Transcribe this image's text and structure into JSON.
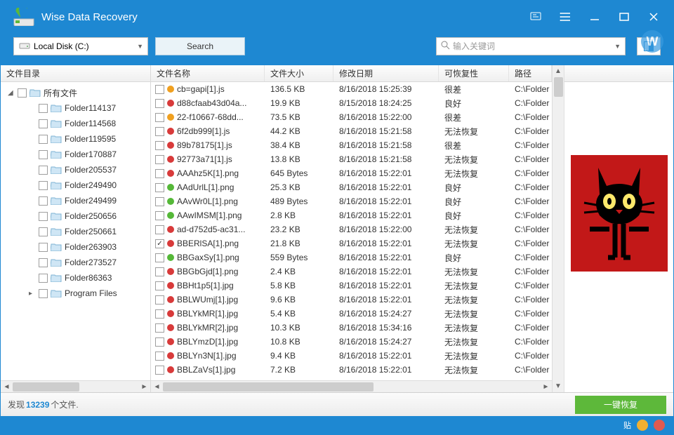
{
  "app": {
    "title": "Wise Data Recovery"
  },
  "toolbar": {
    "drive_label": "Local Disk (C:)",
    "search_label": "Search",
    "search_placeholder": "输入关键词",
    "watermark_letter": "W"
  },
  "sidebar": {
    "header": "文件目录",
    "root_label": "所有文件",
    "folders": [
      {
        "label": "Folder114137"
      },
      {
        "label": "Folder114568"
      },
      {
        "label": "Folder119595"
      },
      {
        "label": "Folder170887"
      },
      {
        "label": "Folder205537"
      },
      {
        "label": "Folder249490"
      },
      {
        "label": "Folder249499"
      },
      {
        "label": "Folder250656"
      },
      {
        "label": "Folder250661"
      },
      {
        "label": "Folder263903"
      },
      {
        "label": "Folder273527"
      },
      {
        "label": "Folder86363"
      },
      {
        "label": "Program Files",
        "expandable": true
      }
    ]
  },
  "grid": {
    "headers": {
      "name": "文件名称",
      "size": "文件大小",
      "date": "修改日期",
      "rec": "可恢复性",
      "path": "路径"
    },
    "rows": [
      {
        "checked": false,
        "status": "orange",
        "name": "cb=gapi[1].js",
        "size": "136.5 KB",
        "date": "8/16/2018 15:25:39",
        "rec": "很差",
        "path": "C:\\Folder"
      },
      {
        "checked": false,
        "status": "red",
        "name": "d88cfaab43d04a...",
        "size": "19.9 KB",
        "date": "8/15/2018 18:24:25",
        "rec": "良好",
        "path": "C:\\Folder"
      },
      {
        "checked": false,
        "status": "orange",
        "name": "22-f10667-68dd...",
        "size": "73.5 KB",
        "date": "8/16/2018 15:22:00",
        "rec": "很差",
        "path": "C:\\Folder"
      },
      {
        "checked": false,
        "status": "red",
        "name": "6f2db999[1].js",
        "size": "44.2 KB",
        "date": "8/16/2018 15:21:58",
        "rec": "无法恢复",
        "path": "C:\\Folder"
      },
      {
        "checked": false,
        "status": "red",
        "name": "89b78175[1].js",
        "size": "38.4 KB",
        "date": "8/16/2018 15:21:58",
        "rec": "很差",
        "path": "C:\\Folder"
      },
      {
        "checked": false,
        "status": "red",
        "name": "92773a71[1].js",
        "size": "13.8 KB",
        "date": "8/16/2018 15:21:58",
        "rec": "无法恢复",
        "path": "C:\\Folder"
      },
      {
        "checked": false,
        "status": "red",
        "name": "AAAhz5K[1].png",
        "size": "645 Bytes",
        "date": "8/16/2018 15:22:01",
        "rec": "无法恢复",
        "path": "C:\\Folder"
      },
      {
        "checked": false,
        "status": "green",
        "name": "AAdUrlL[1].png",
        "size": "25.3 KB",
        "date": "8/16/2018 15:22:01",
        "rec": "良好",
        "path": "C:\\Folder"
      },
      {
        "checked": false,
        "status": "green",
        "name": "AAvWr0L[1].png",
        "size": "489 Bytes",
        "date": "8/16/2018 15:22:01",
        "rec": "良好",
        "path": "C:\\Folder"
      },
      {
        "checked": false,
        "status": "green",
        "name": "AAwIMSM[1].png",
        "size": "2.8 KB",
        "date": "8/16/2018 15:22:01",
        "rec": "良好",
        "path": "C:\\Folder"
      },
      {
        "checked": false,
        "status": "red",
        "name": "ad-d752d5-ac31...",
        "size": "23.2 KB",
        "date": "8/16/2018 15:22:00",
        "rec": "无法恢复",
        "path": "C:\\Folder"
      },
      {
        "checked": true,
        "status": "red",
        "name": "BBERlSA[1].png",
        "size": "21.8 KB",
        "date": "8/16/2018 15:22:01",
        "rec": "无法恢复",
        "path": "C:\\Folder"
      },
      {
        "checked": false,
        "status": "green",
        "name": "BBGaxSy[1].png",
        "size": "559 Bytes",
        "date": "8/16/2018 15:22:01",
        "rec": "良好",
        "path": "C:\\Folder"
      },
      {
        "checked": false,
        "status": "red",
        "name": "BBGbGjd[1].png",
        "size": "2.4 KB",
        "date": "8/16/2018 15:22:01",
        "rec": "无法恢复",
        "path": "C:\\Folder"
      },
      {
        "checked": false,
        "status": "red",
        "name": "BBHt1p5[1].jpg",
        "size": "5.8 KB",
        "date": "8/16/2018 15:22:01",
        "rec": "无法恢复",
        "path": "C:\\Folder"
      },
      {
        "checked": false,
        "status": "red",
        "name": "BBLWUmj[1].jpg",
        "size": "9.6 KB",
        "date": "8/16/2018 15:22:01",
        "rec": "无法恢复",
        "path": "C:\\Folder"
      },
      {
        "checked": false,
        "status": "red",
        "name": "BBLYkMR[1].jpg",
        "size": "5.4 KB",
        "date": "8/16/2018 15:24:27",
        "rec": "无法恢复",
        "path": "C:\\Folder"
      },
      {
        "checked": false,
        "status": "red",
        "name": "BBLYkMR[2].jpg",
        "size": "10.3 KB",
        "date": "8/16/2018 15:34:16",
        "rec": "无法恢复",
        "path": "C:\\Folder"
      },
      {
        "checked": false,
        "status": "red",
        "name": "BBLYmzD[1].jpg",
        "size": "10.8 KB",
        "date": "8/16/2018 15:24:27",
        "rec": "无法恢复",
        "path": "C:\\Folder"
      },
      {
        "checked": false,
        "status": "red",
        "name": "BBLYn3N[1].jpg",
        "size": "9.4 KB",
        "date": "8/16/2018 15:22:01",
        "rec": "无法恢复",
        "path": "C:\\Folder"
      },
      {
        "checked": false,
        "status": "red",
        "name": "BBLZaVs[1].jpg",
        "size": "7.2 KB",
        "date": "8/16/2018 15:22:01",
        "rec": "无法恢复",
        "path": "C:\\Folder"
      }
    ]
  },
  "status": {
    "prefix": "发现",
    "count": "13239",
    "suffix": "个文件.",
    "recover_label": "一键恢复"
  },
  "footer": {
    "tieba_label": "贴"
  }
}
